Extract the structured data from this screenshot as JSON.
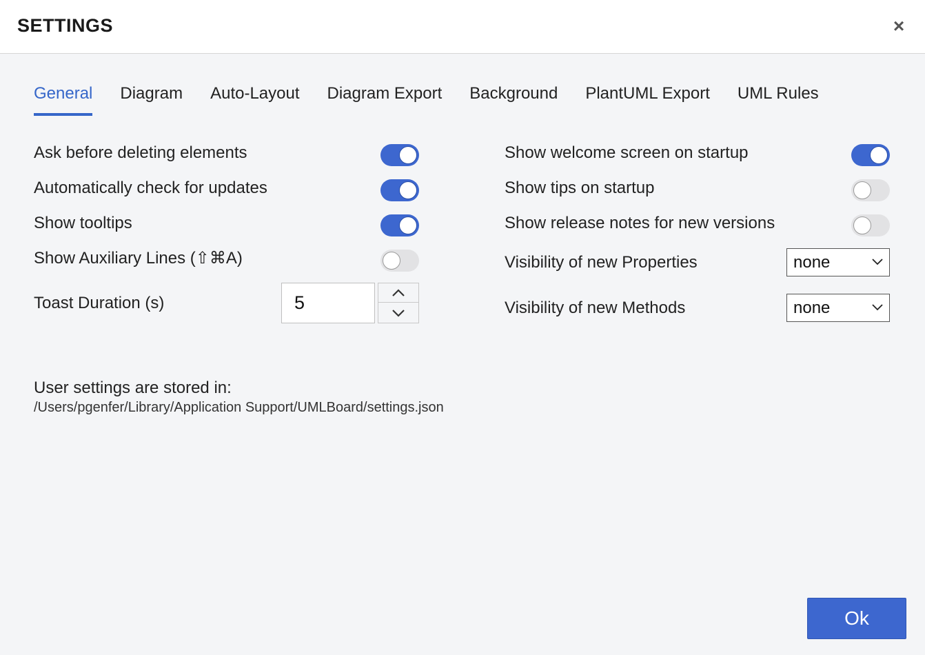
{
  "header": {
    "title": "SETTINGS",
    "close_glyph": "×"
  },
  "tabs": [
    {
      "label": "General",
      "active": true
    },
    {
      "label": "Diagram",
      "active": false
    },
    {
      "label": "Auto-Layout",
      "active": false
    },
    {
      "label": "Diagram Export",
      "active": false
    },
    {
      "label": "Background",
      "active": false
    },
    {
      "label": "PlantUML Export",
      "active": false
    },
    {
      "label": "UML Rules",
      "active": false
    }
  ],
  "left": {
    "ask_delete": {
      "label": "Ask before deleting elements",
      "on": true
    },
    "check_updates": {
      "label": "Automatically check for updates",
      "on": true
    },
    "tooltips": {
      "label": "Show tooltips",
      "on": true
    },
    "aux_lines": {
      "label": "Show Auxiliary Lines (⇧⌘A)",
      "on": false
    },
    "toast": {
      "label": "Toast Duration (s)",
      "value": "5"
    }
  },
  "right": {
    "welcome": {
      "label": "Show welcome screen on startup",
      "on": true
    },
    "tips": {
      "label": "Show tips on startup",
      "on": false
    },
    "release_notes": {
      "label": "Show release notes for new versions",
      "on": false
    },
    "vis_props": {
      "label": "Visibility of new Properties",
      "value": "none"
    },
    "vis_methods": {
      "label": "Visibility of new Methods",
      "value": "none"
    }
  },
  "info": {
    "title": "User settings are stored in:",
    "path": "/Users/pgenfer/Library/Application Support/UMLBoard/settings.json"
  },
  "footer": {
    "ok_label": "Ok"
  },
  "colors": {
    "accent": "#3d67cf",
    "tab_active": "#3566c9",
    "toggle_off": "#e2e2e4"
  },
  "icons": {
    "close": "close-icon",
    "up": "chevron-up-icon",
    "down": "chevron-down-icon"
  }
}
